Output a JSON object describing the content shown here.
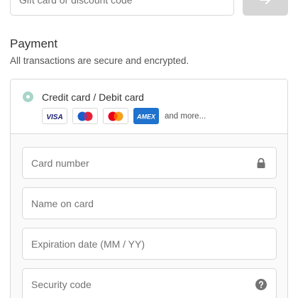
{
  "discount": {
    "placeholder": "Gift card or discount code",
    "apply_icon": "arrow-right-icon"
  },
  "payment": {
    "title": "Payment",
    "subtitle": "All transactions are secure and encrypted.",
    "method": {
      "label": "Credit card / Debit card",
      "selected": true,
      "logos": [
        "VISA",
        "Maestro",
        "Mastercard",
        "AMEX"
      ],
      "and_more": "and more..."
    },
    "fields": {
      "card_number": {
        "placeholder": "Card number",
        "icon": "lock-icon"
      },
      "name_on_card": {
        "placeholder": "Name on card"
      },
      "expiration": {
        "placeholder": "Expiration date (MM / YY)"
      },
      "security_code": {
        "placeholder": "Security code",
        "icon": "help-icon"
      }
    }
  },
  "colors": {
    "radio_accent": "#a9d5c9",
    "apply_button_bg": "#d6d6d6",
    "amex_blue": "#1f72cd",
    "visa_blue": "#1a1f71"
  }
}
